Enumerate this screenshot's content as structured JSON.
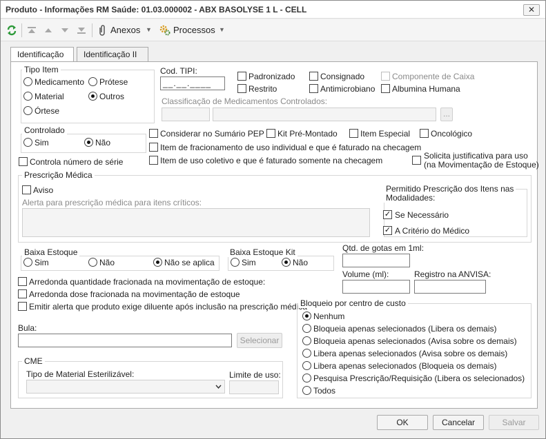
{
  "window": {
    "title": "Produto - Informações RM Saúde: 01.03.000002 - ABX BASOLYSE 1 L - CELL",
    "close_glyph": "✕"
  },
  "toolbar": {
    "anexos": "Anexos",
    "processos": "Processos"
  },
  "tabs": [
    {
      "label": "Identificação"
    },
    {
      "label": "Identificação II"
    }
  ],
  "tipo_item": {
    "legend": "Tipo Item",
    "options": [
      {
        "label": "Medicamento"
      },
      {
        "label": "Prótese"
      },
      {
        "label": "Material"
      },
      {
        "label": "Outros"
      },
      {
        "label": "Órtese"
      }
    ],
    "selected": "Outros"
  },
  "cod_tipi": {
    "label": "Cod. TIPI:",
    "value": "__.__.____"
  },
  "flags": [
    {
      "label": "Padronizado",
      "checked": false
    },
    {
      "label": "Consignado",
      "checked": false
    },
    {
      "label": "Componente de Caixa",
      "checked": false
    },
    {
      "label": "Restrito",
      "checked": false
    },
    {
      "label": "Antimicrobiano",
      "checked": false
    },
    {
      "label": "Albumina Humana",
      "checked": false
    }
  ],
  "classificacao": {
    "label": "Classificação de Medicamentos Controlados:",
    "button": "..."
  },
  "controlado": {
    "legend": "Controlado",
    "options": [
      {
        "label": "Sim"
      },
      {
        "label": "Não"
      }
    ],
    "selected": "Não"
  },
  "controla_serie": {
    "label": "Controla número de série",
    "checked": false
  },
  "checks_mid": [
    {
      "label": "Considerar no Sumário PEP",
      "checked": false
    },
    {
      "label": "Kit Pré-Montado",
      "checked": false
    },
    {
      "label": "Item Especial",
      "checked": false
    },
    {
      "label": "Oncológico",
      "checked": false
    },
    {
      "label": "Item de fracionamento de uso individual e que é faturado na checagem",
      "checked": false
    },
    {
      "label": "Item de uso coletivo e que é faturado somente na checagem",
      "checked": false
    }
  ],
  "solicita_justificativa": {
    "line1": "Solicita justificativa para uso",
    "line2": "(na Movimentação de Estoque)",
    "checked": false
  },
  "prescricao": {
    "legend": "Prescrição Médica",
    "aviso": {
      "label": "Aviso",
      "checked": false
    },
    "alerta_label": "Alerta para prescrição médica para itens críticos:",
    "alerta_value": "",
    "modalidades": {
      "legend_line1": "Permitido Prescrição dos Itens nas",
      "legend_line2": "Modalidades:",
      "items": [
        {
          "label": "Se Necessário",
          "checked": true
        },
        {
          "label": "A Critério do Médico",
          "checked": true
        }
      ]
    }
  },
  "baixa_estoque": {
    "legend": "Baixa Estoque",
    "options": [
      {
        "label": "Sim"
      },
      {
        "label": "Não"
      },
      {
        "label": "Não se aplica"
      }
    ],
    "selected": "Não se aplica"
  },
  "baixa_estoque_kit": {
    "legend": "Baixa Estoque Kit",
    "options": [
      {
        "label": "Sim"
      },
      {
        "label": "Não"
      }
    ],
    "selected": "Não"
  },
  "qtd_gotas": {
    "label": "Qtd. de gotas em 1ml:",
    "value": ""
  },
  "volume": {
    "label": "Volume (ml):",
    "value": ""
  },
  "registro_anvisa": {
    "label": "Registro na ANVISA:",
    "value": ""
  },
  "arredonda": [
    {
      "label": "Arredonda quantidade fracionada na movimentação de estoque:",
      "checked": false
    },
    {
      "label": "Arredonda dose fracionada na movimentação de estoque",
      "checked": false
    },
    {
      "label": "Emitir alerta que produto exige diluente após inclusão na prescrição médica",
      "checked": false
    }
  ],
  "bula": {
    "label": "Bula:",
    "value": "",
    "button": "Selecionar"
  },
  "cme": {
    "legend": "CME",
    "tipo_label": "Tipo de Material Esterilizável:",
    "tipo_value": "",
    "limite_label": "Limite de uso:",
    "limite_value": ""
  },
  "bloqueio": {
    "legend": "Bloqueio por centro de custo",
    "options": [
      {
        "label": "Nenhum"
      },
      {
        "label": "Bloqueia apenas selecionados (Libera os demais)"
      },
      {
        "label": "Bloqueia apenas selecionados (Avisa sobre os demais)"
      },
      {
        "label": "Libera apenas selecionados (Avisa sobre os demais)"
      },
      {
        "label": "Libera apenas selecionados (Bloqueia os demais)"
      },
      {
        "label": "Pesquisa Prescrição/Requisição (Libera os selecionados)"
      },
      {
        "label": "Todos"
      }
    ],
    "selected": "Nenhum"
  },
  "footer": {
    "ok": "OK",
    "cancel": "Cancelar",
    "save": "Salvar"
  },
  "colors": {
    "refresh_icon": "#2e9a3a",
    "processos_icon": "#d79a1b"
  }
}
